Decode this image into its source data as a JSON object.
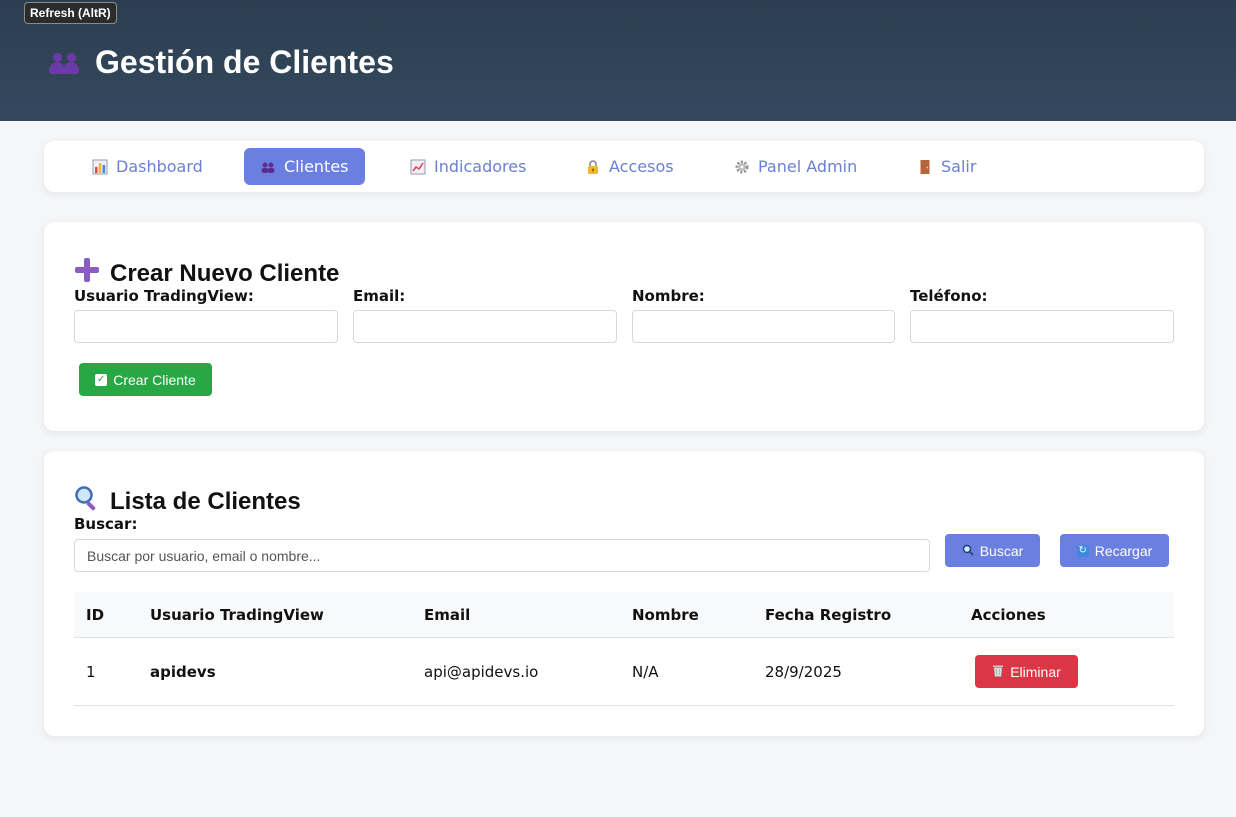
{
  "tooltip": "Refresh (AltR)",
  "header": {
    "title": "Gestión de Clientes",
    "icon": "people-icon"
  },
  "nav": {
    "items": [
      {
        "label": "Dashboard",
        "icon": "bar-chart-icon"
      },
      {
        "label": "Clientes",
        "icon": "people-icon",
        "active": true
      },
      {
        "label": "Indicadores",
        "icon": "line-chart-icon"
      },
      {
        "label": "Accesos",
        "icon": "lock-icon"
      },
      {
        "label": "Panel Admin",
        "icon": "gear-icon"
      },
      {
        "label": "Salir",
        "icon": "door-icon"
      }
    ]
  },
  "create": {
    "title": "Crear Nuevo Cliente",
    "icon": "plus-icon",
    "fields": [
      {
        "label": "Usuario TradingView:",
        "value": ""
      },
      {
        "label": "Email:",
        "value": ""
      },
      {
        "label": "Nombre:",
        "value": ""
      },
      {
        "label": "Teléfono:",
        "value": ""
      }
    ],
    "submit_label": "Crear Cliente"
  },
  "list": {
    "title": "Lista de Clientes",
    "icon": "search-icon",
    "search_label": "Buscar:",
    "search_placeholder": "Buscar por usuario, email o nombre...",
    "search_button": "Buscar",
    "reload_button": "Recargar",
    "columns": [
      "ID",
      "Usuario TradingView",
      "Email",
      "Nombre",
      "Fecha Registro",
      "Acciones"
    ],
    "rows": [
      {
        "id": "1",
        "usuario": "apidevs",
        "email": "api@apidevs.io",
        "nombre": "N/A",
        "fecha": "28/9/2025",
        "action": "Eliminar"
      }
    ]
  },
  "colors": {
    "header_bg": "#2c3e50",
    "accent": "#6b7fe0",
    "success": "#28a745",
    "danger": "#dc3545"
  }
}
